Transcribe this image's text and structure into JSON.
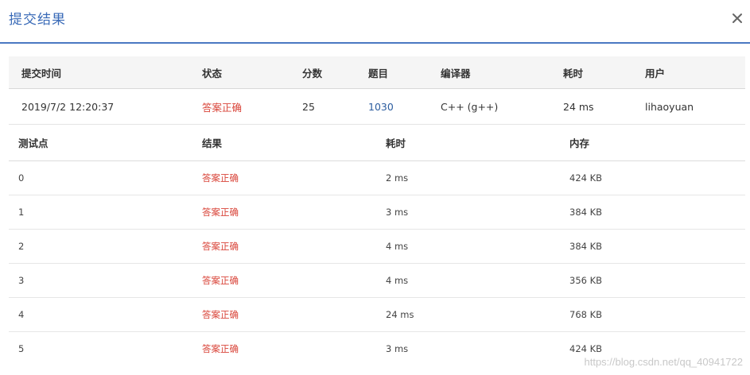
{
  "dialog": {
    "title": "提交结果",
    "close_icon": "close-icon"
  },
  "summary": {
    "headers": [
      "提交时间",
      "状态",
      "分数",
      "题目",
      "编译器",
      "耗时",
      "用户"
    ],
    "row": {
      "time": "2019/7/2 12:20:37",
      "status": "答案正确",
      "score": "25",
      "problem": "1030",
      "compiler": "C++ (g++)",
      "elapsed": "24 ms",
      "user": "lihaoyuan"
    }
  },
  "cases": {
    "headers": [
      "测试点",
      "结果",
      "耗时",
      "内存"
    ],
    "rows": [
      {
        "id": "0",
        "result": "答案正确",
        "time": "2 ms",
        "memory": "424 KB"
      },
      {
        "id": "1",
        "result": "答案正确",
        "time": "3 ms",
        "memory": "384 KB"
      },
      {
        "id": "2",
        "result": "答案正确",
        "time": "4 ms",
        "memory": "384 KB"
      },
      {
        "id": "3",
        "result": "答案正确",
        "time": "4 ms",
        "memory": "356 KB"
      },
      {
        "id": "4",
        "result": "答案正确",
        "time": "24 ms",
        "memory": "768 KB"
      },
      {
        "id": "5",
        "result": "答案正确",
        "time": "3 ms",
        "memory": "424 KB"
      }
    ]
  },
  "watermark": "https://blog.csdn.net/qq_40941722",
  "colors": {
    "accent": "#3a6bb8",
    "success_text": "#d9453a",
    "link": "#2c5d9f",
    "header_bg": "#f5f5f5"
  }
}
